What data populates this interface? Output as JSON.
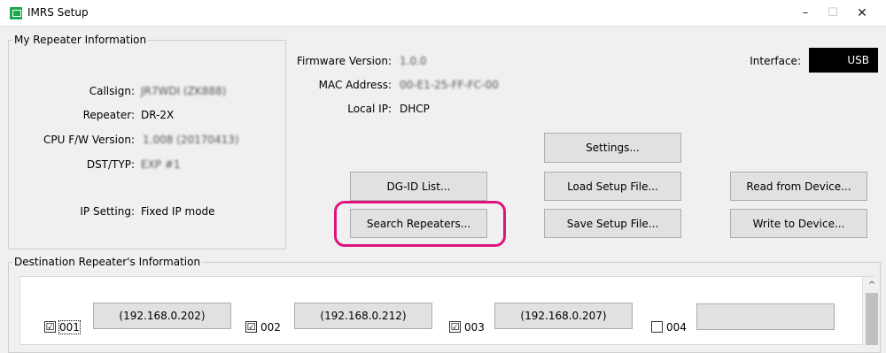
{
  "window": {
    "title": "IMRS Setup",
    "minimize": "–",
    "maximize": "☐",
    "close": "✕"
  },
  "my_info": {
    "legend": "My Repeater Information",
    "callsign_label": "Callsign:",
    "callsign_value": "JR7WDI (ZK888)",
    "repeater_label": "Repeater:",
    "repeater_value": "DR-2X",
    "cpu_fw_label": "CPU F/W Version:",
    "cpu_fw_value": "1.008 (20170413)",
    "dst_typ_label": "DST/TYP:",
    "dst_typ_value": "EXP #1",
    "ip_setting_label": "IP Setting:",
    "ip_setting_value": "Fixed IP mode"
  },
  "device": {
    "firmware_label": "Firmware Version:",
    "firmware_value": "1.0.0",
    "mac_label": "MAC Address:",
    "mac_value": "00-E1-25-FF-FC-00",
    "local_ip_label": "Local IP:",
    "local_ip_value": "DHCP",
    "interface_label": "Interface:",
    "interface_value": "USB"
  },
  "buttons": {
    "settings": "Settings...",
    "dgid_list": "DG-ID List...",
    "load_setup": "Load Setup File...",
    "read_device": "Read from Device...",
    "search_repeaters": "Search Repeaters...",
    "save_setup": "Save Setup File...",
    "write_device": "Write to Device..."
  },
  "dest_info": {
    "legend": "Destination Repeater's Information",
    "scroll_up": "^",
    "entries": [
      {
        "num": "001",
        "checked": "☑",
        "ip": "(192.168.0.202)"
      },
      {
        "num": "002",
        "checked": "☑",
        "ip": "(192.168.0.212)"
      },
      {
        "num": "003",
        "checked": "☑",
        "ip": "(192.168.0.207)"
      },
      {
        "num": "004",
        "checked": "",
        "ip": ""
      }
    ]
  },
  "colors": {
    "highlight": "#e0127f",
    "interface_bg": "#000000",
    "app_icon": "#1aa84a"
  }
}
